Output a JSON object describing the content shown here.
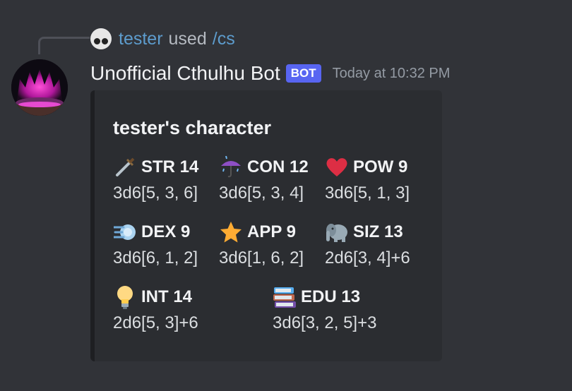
{
  "reply": {
    "username": "tester",
    "used_text": "used",
    "command": "/cs"
  },
  "message": {
    "author": "Unofficial Cthulhu Bot",
    "bot_tag": "BOT",
    "timestamp": "Today at 10:32 PM"
  },
  "embed": {
    "title": "tester's character",
    "fields": [
      {
        "icon": "dagger-icon",
        "name": "STR 14",
        "value": "3d6[5, 3, 6]"
      },
      {
        "icon": "umbrella-rain-icon",
        "name": "CON 12",
        "value": "3d6[5, 3, 4]"
      },
      {
        "icon": "heart-icon",
        "name": "POW 9",
        "value": "3d6[5, 1, 3]"
      },
      {
        "icon": "dash-icon",
        "name": "DEX 9",
        "value": "3d6[6, 1, 2]"
      },
      {
        "icon": "star-icon",
        "name": "APP 9",
        "value": "3d6[1, 6, 2]"
      },
      {
        "icon": "elephant-icon",
        "name": "SIZ 13",
        "value": "2d6[3, 4]+6"
      },
      {
        "icon": "lightbulb-icon",
        "name": "INT 14",
        "value": "2d6[5, 3]+6"
      },
      {
        "icon": "books-icon",
        "name": "EDU 13",
        "value": "3d6[3, 2, 5]+3"
      }
    ]
  },
  "colors": {
    "background": "#313338",
    "embed_background": "#2b2d31",
    "bot_tag": "#5865f2",
    "username_link": "#5d9ccd"
  }
}
